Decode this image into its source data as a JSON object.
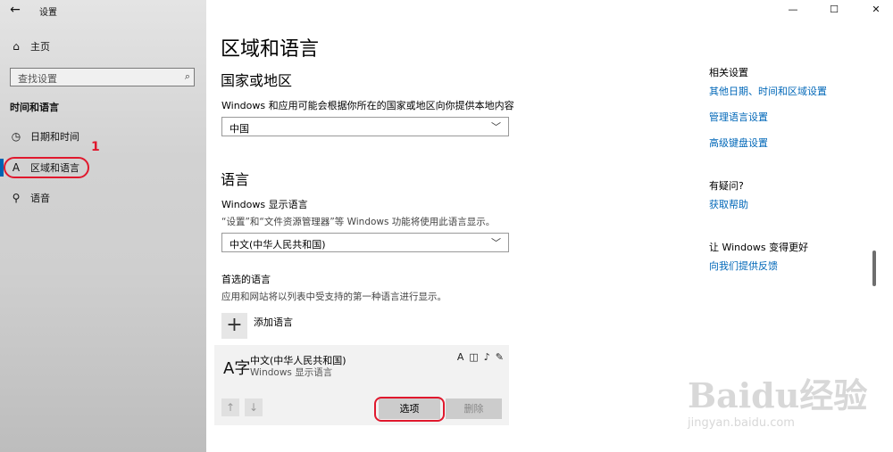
{
  "app": {
    "title": "设置",
    "back_icon": "back-arrow-icon"
  },
  "window_controls": {
    "minimize": "—",
    "maximize": "☐",
    "close": "✕"
  },
  "sidebar": {
    "home_label": "主页",
    "search_placeholder": "查找设置",
    "section": "时间和语言",
    "items": [
      {
        "label": "日期和时间",
        "icon": "clock-calendar-icon"
      },
      {
        "label": "区域和语言",
        "icon": "language-icon",
        "active": true
      },
      {
        "label": "语音",
        "icon": "microphone-icon"
      }
    ],
    "annotation_number": "1"
  },
  "main": {
    "title": "区域和语言",
    "country": {
      "heading": "国家或地区",
      "label": "Windows 和应用可能会根据你所在的国家或地区向你提供本地内容",
      "value": "中国"
    },
    "language": {
      "heading": "语言",
      "display_label": "Windows 显示语言",
      "display_desc": "“设置”和“文件资源管理器”等 Windows 功能将使用此语言显示。",
      "display_value": "中文(中华人民共和国)",
      "preferred_label": "首选的语言",
      "preferred_desc": "应用和网站将以列表中受支持的第一种语言进行显示。",
      "add_label": "添加语言",
      "card": {
        "glyph": "A字",
        "name": "中文(中华人民共和国)",
        "sub": "Windows 显示语言",
        "options_label": "选项",
        "remove_label": "删除"
      }
    }
  },
  "related": {
    "heading": "相关设置",
    "links": [
      "其他日期、时间和区域设置",
      "管理语言设置",
      "高级键盘设置"
    ],
    "question_heading": "有疑问?",
    "help_link": "获取帮助",
    "improve_heading": "让 Windows 变得更好",
    "feedback_link": "向我们提供反馈"
  },
  "watermark": {
    "main": "Baidu经验",
    "sub": "jingyan.baidu.com"
  },
  "colors": {
    "accent": "#0063b1",
    "link": "#0067b8",
    "annotation": "#e0182d"
  }
}
